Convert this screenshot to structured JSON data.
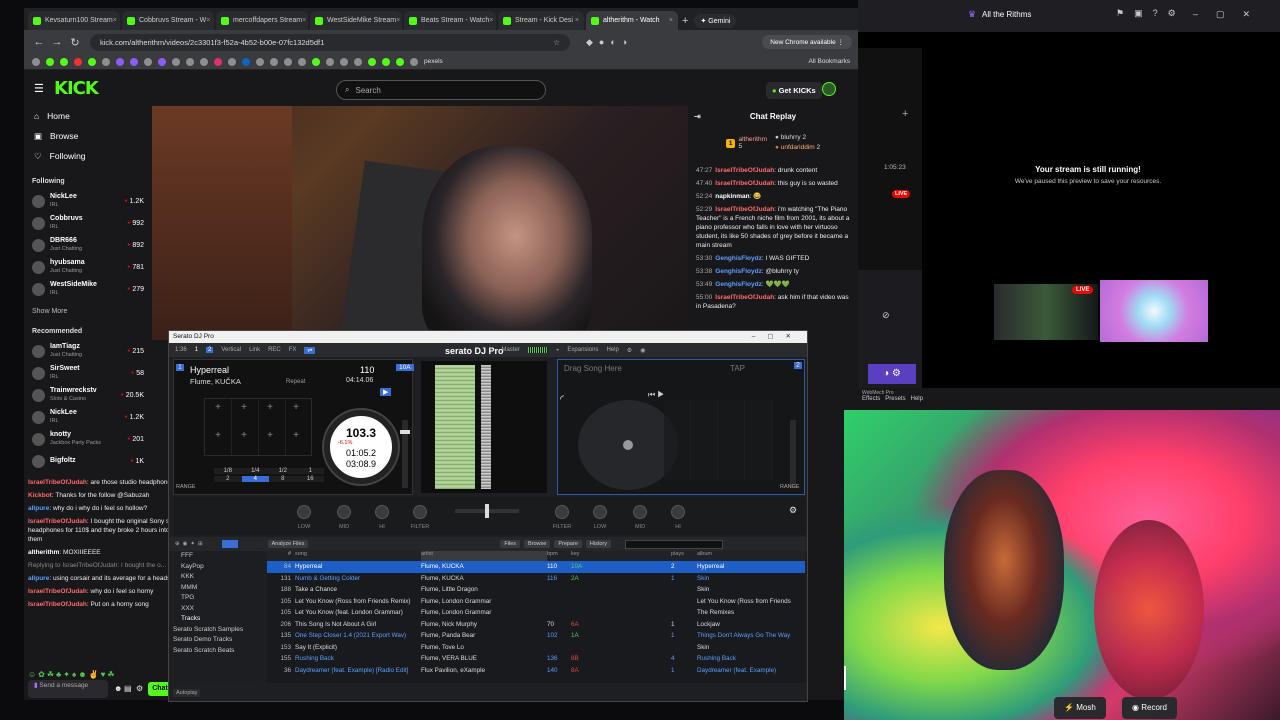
{
  "browser": {
    "tabs": [
      {
        "label": "Kevsaturn100 Stream"
      },
      {
        "label": "Cobbruvs Stream - W"
      },
      {
        "label": "mercoffdapers Stream"
      },
      {
        "label": "WestSideMike Stream"
      },
      {
        "label": "Beats Stream - Watch"
      },
      {
        "label": "Stream - Kick Desi"
      },
      {
        "label": "altherithm - Watch"
      }
    ],
    "gemini_label": "Gemini",
    "url": "kick.com/altherithm/videos/2c3301f3-f52a-4b52-b00e-07fc132d5df1",
    "new_chrome": "New Chrome available",
    "all_bookmarks": "All Bookmarks",
    "pexels": "pexels"
  },
  "kick": {
    "logo": "KICK",
    "search_placeholder": "Search",
    "get_kicks": "Get KICKs",
    "nav": [
      {
        "label": "Home"
      },
      {
        "label": "Browse"
      },
      {
        "label": "Following"
      }
    ],
    "following_label": "Following",
    "following": [
      {
        "name": "NickLee",
        "cat": "IRL",
        "viewers": "1.2K"
      },
      {
        "name": "Cobbruvs",
        "cat": "IRL",
        "viewers": "992"
      },
      {
        "name": "DBR666",
        "cat": "Just Chatting",
        "viewers": "892"
      },
      {
        "name": "hyubsama",
        "cat": "Just Chatting",
        "viewers": "781"
      },
      {
        "name": "WestSideMike",
        "cat": "IRL",
        "viewers": "279"
      }
    ],
    "show_more": "Show More",
    "recommended_label": "Recommended",
    "recommended": [
      {
        "name": "IamTiagz",
        "cat": "Just Chatting",
        "viewers": "215"
      },
      {
        "name": "SirSweet",
        "cat": "IRL",
        "viewers": "58"
      },
      {
        "name": "Trainwreckstv",
        "cat": "Slots & Casino",
        "viewers": "20.5K"
      },
      {
        "name": "NickLee",
        "cat": "IRL",
        "viewers": "1.2K"
      },
      {
        "name": "knotty",
        "cat": "Jackbox Party Packs",
        "viewers": "201"
      },
      {
        "name": "Bigfoltz",
        "cat": "",
        "viewers": "1K"
      }
    ]
  },
  "chat": {
    "title": "Chat Replay",
    "gifters": [
      {
        "rank": "1",
        "name": "altherithm",
        "count": "5"
      },
      {
        "rank": "2",
        "name": "bluhrry",
        "count": "2"
      },
      {
        "rank": "3",
        "name": "unfdariddim",
        "count": "2"
      }
    ],
    "messages": [
      {
        "ts": "47:27",
        "user": "IsraelTribeOfJudah",
        "text": "drunk content",
        "color": "#ff6b6b"
      },
      {
        "ts": "47:40",
        "user": "IsraelTribeOfJudah",
        "text": "this guy is so wasted",
        "color": "#ff6b6b"
      },
      {
        "ts": "52:24",
        "user": "napkinman",
        "text": "😂",
        "color": "#fff"
      },
      {
        "ts": "52:29",
        "user": "IsraelTribeOfJudah",
        "text": "i'm watching \"The Piano Teacher\" is a French niche film from 2001, its about a piano professor who falls in love with her virtuoso student, its like 50 shades of grey before it became a main stream",
        "color": "#ff6b6b"
      },
      {
        "ts": "53:30",
        "user": "GenghisFloydz",
        "text": "I WAS GIFTED",
        "color": "#5aa0ff"
      },
      {
        "ts": "53:38",
        "user": "GenghisFloydz",
        "text": "@bluhrry ty",
        "color": "#5aa0ff"
      },
      {
        "ts": "53:49",
        "user": "GenghisFloydz",
        "text": "💚💚💚",
        "color": "#5aa0ff"
      },
      {
        "ts": "55:00",
        "user": "IsraelTribeOfJudah",
        "text": "ask him if that video was in Pasadena?",
        "color": "#ff6b6b"
      }
    ]
  },
  "chat2": {
    "messages": [
      {
        "user": "IsraelTribeOfJudah",
        "text": "are those studio headphones?",
        "color": "#ff6b6b"
      },
      {
        "user": "Kickbot",
        "text": "Thanks for the follow @Sabuzah",
        "color": "#ff6b6b"
      },
      {
        "user": "allpure",
        "text": "why do i why do i feel so hollow?",
        "color": "#5aa0ff"
      },
      {
        "user": "IsraelTribeOfJudah",
        "text": "I bought the original Sony studio headphones for 110$ and they broke 2 hours into using them",
        "color": "#ff6b6b"
      },
      {
        "user": "altherithm",
        "text": "MOXIIIEEEE",
        "color": "#ffffff"
      },
      {
        "user": "allpure",
        "text": "using corsair and its average for a headset",
        "color": "#5aa0ff"
      },
      {
        "user": "IsraelTribeOfJudah",
        "text": "why do i feel so horny",
        "color": "#ff6b6b"
      },
      {
        "user": "IsraelTribeOfJudah",
        "text": "Put on a horny song",
        "color": "#ff6b6b"
      }
    ],
    "reply_to": "Replying to IsraelTribeOfJudah: I bought the o...",
    "send_placeholder": "Send a message",
    "chat_button": "Chat"
  },
  "serato": {
    "window_title": "Serato DJ Pro",
    "brand": "serato DJ Pro",
    "toolbar": [
      "1:36",
      "Vertical",
      "Link",
      "REC",
      "FX",
      "Master",
      "Expansions",
      "Help"
    ],
    "deckA": {
      "number": "1",
      "title": "Hyperreal",
      "artist": "Flume, KUČKA",
      "bpm": "110",
      "key": "10A",
      "repeat": "Repeat",
      "time_total": "04:14.06",
      "platter_bpm": "103.3",
      "platter_pct": "-6.1%",
      "elapsed": "01:05.2",
      "remaining": "03:08.9",
      "loops": [
        "1/8",
        "1/4",
        "1/2",
        "1",
        "2",
        "4",
        "8",
        "16"
      ],
      "range": "RANGE"
    },
    "deckB": {
      "number": "2",
      "placeholder": "Drag Song Here",
      "tap": "TAP",
      "range": "RANGE"
    },
    "mixer": [
      "LOW",
      "MID",
      "HI",
      "FILTER",
      "FILTER",
      "LOW",
      "MID",
      "HI"
    ],
    "library_toolbar": [
      "Analyze Files",
      "Files",
      "Browse",
      "Prepare",
      "History"
    ],
    "crates": [
      "FFF",
      "KayPop",
      "KKK",
      "MMM",
      "TPG",
      "XXX",
      "Tracks",
      "Serato Scratch Samples",
      "Serato Demo Tracks",
      "Serato Scratch Beats"
    ],
    "autoplay": "Autoplay",
    "columns": {
      "num": "#",
      "song": "song",
      "artist": "artist",
      "bpm": "bpm",
      "key": "key",
      "plays": "plays",
      "album": "album"
    },
    "tracks": [
      {
        "n": "84",
        "song": "Hyperreal",
        "artist": "Flume, KUČKA",
        "bpm": "110",
        "key": "10A",
        "plays": "2",
        "album": "Hyperreal",
        "sel": true
      },
      {
        "n": "131",
        "song": "Numb & Getting Colder",
        "artist": "Flume, KUČKA",
        "bpm": "116",
        "key": "2A",
        "plays": "1",
        "album": "Skin",
        "blue": true
      },
      {
        "n": "188",
        "song": "Take a Chance",
        "artist": "Flume, Little Dragon",
        "bpm": "",
        "key": "",
        "plays": "",
        "album": "Skin"
      },
      {
        "n": "105",
        "song": "Let You Know (Ross from Friends Remix)",
        "artist": "Flume, London Grammar",
        "bpm": "",
        "key": "",
        "plays": "",
        "album": "Let You Know (Ross from Friends"
      },
      {
        "n": "105",
        "song": "Let You Know (feat. London Grammar)",
        "artist": "Flume, London Grammar",
        "bpm": "",
        "key": "",
        "plays": "",
        "album": "The Remixes"
      },
      {
        "n": "206",
        "song": "This Song Is Not About A Girl",
        "artist": "Flume, Nick Murphy",
        "bpm": "70",
        "key": "6A",
        "plays": "1",
        "album": "Lockjaw"
      },
      {
        "n": "135",
        "song": "One Step Closer 1.4 (2021 Export Wav)",
        "artist": "Flume, Panda Bear",
        "bpm": "102",
        "key": "1A",
        "plays": "1",
        "album": "Things Don't Always Go The Way",
        "blue": true
      },
      {
        "n": "153",
        "song": "Say It (Explicit)",
        "artist": "Flume, Tove Lo",
        "bpm": "",
        "key": "",
        "plays": "",
        "album": "Skin"
      },
      {
        "n": "155",
        "song": "Rushing Back",
        "artist": "Flume, VERA BLUE",
        "bpm": "136",
        "key": "8B",
        "plays": "4",
        "album": "Rushing Back",
        "blue": true
      },
      {
        "n": "36",
        "song": "Daydreamer (feat. Example) [Radio Edit]",
        "artist": "Flux Pavilion, eXample",
        "bpm": "140",
        "key": "8A",
        "plays": "1",
        "album": "Daydreamer (feat. Example)",
        "blue": true
      }
    ]
  },
  "right": {
    "title": "All the Rithms",
    "time": "1:05:23",
    "still_running": "Your stream is still running!",
    "paused": "We've paused this preview to save your resources.",
    "live": "LIVE",
    "strip": "WebMech Pro",
    "menu": [
      "Effects",
      "Presets",
      "Help"
    ],
    "mosh": "Mosh",
    "record": "Record"
  },
  "colors": {
    "kick_green": "#53fc18",
    "live_red": "#eb0400",
    "serato_blue": "#1d5fc7"
  }
}
